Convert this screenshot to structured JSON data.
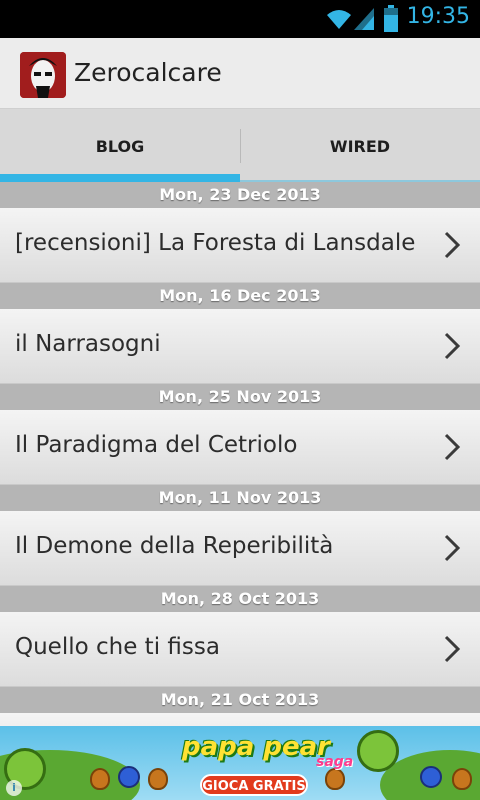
{
  "status_bar": {
    "time": "19:35"
  },
  "app": {
    "title": "Zerocalcare"
  },
  "tabs": [
    {
      "label": "BLOG",
      "selected": true
    },
    {
      "label": "WIRED",
      "selected": false
    }
  ],
  "posts": [
    {
      "date": "Mon, 23 Dec 2013",
      "title": "[recensioni] La Foresta di Lansdale"
    },
    {
      "date": "Mon, 16 Dec 2013",
      "title": "il Narrasogni"
    },
    {
      "date": "Mon, 25 Nov 2013",
      "title": "Il Paradigma del Cetriolo"
    },
    {
      "date": "Mon, 11 Nov 2013",
      "title": "Il Demone della Reperibilità"
    },
    {
      "date": "Mon, 28 Oct 2013",
      "title": "Quello che ti fissa"
    },
    {
      "date": "Mon, 21 Oct 2013",
      "title": ""
    }
  ],
  "ad": {
    "brand": "papa pear",
    "tagline": "saga",
    "cta": "GIOCA GRATIS",
    "info": "i"
  },
  "colors": {
    "accent": "#33b5e5",
    "status_bar": "#000000",
    "section_header": "#b5b5b5"
  }
}
